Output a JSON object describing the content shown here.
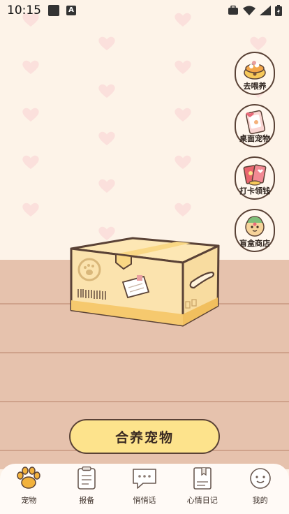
{
  "status_bar": {
    "time": "10:15"
  },
  "side_buttons": [
    {
      "label": "去喂养",
      "icon": "food-bowl-icon"
    },
    {
      "label": "桌面宠物",
      "icon": "phone-pet-icon"
    },
    {
      "label": "打卡领钱",
      "icon": "red-envelope-icon"
    },
    {
      "label": "盲盒商店",
      "icon": "blind-box-pet-icon"
    }
  ],
  "main": {
    "adopt_label": "合养宠物"
  },
  "nav": {
    "items": [
      {
        "label": "宠物",
        "icon": "paw-icon",
        "active": true
      },
      {
        "label": "报备",
        "icon": "clipboard-icon",
        "active": false
      },
      {
        "label": "悄悄话",
        "icon": "chat-bubble-icon",
        "active": false
      },
      {
        "label": "心情日记",
        "icon": "diary-icon",
        "active": false
      },
      {
        "label": "我的",
        "icon": "smiley-face-icon",
        "active": false
      }
    ]
  },
  "colors": {
    "wall": "#fdf3e8",
    "heart": "#fbe0dc",
    "floor": "#e6c2ad",
    "button": "#fde38c",
    "outline": "#5a4236",
    "paw_active": "#f2b23c"
  }
}
